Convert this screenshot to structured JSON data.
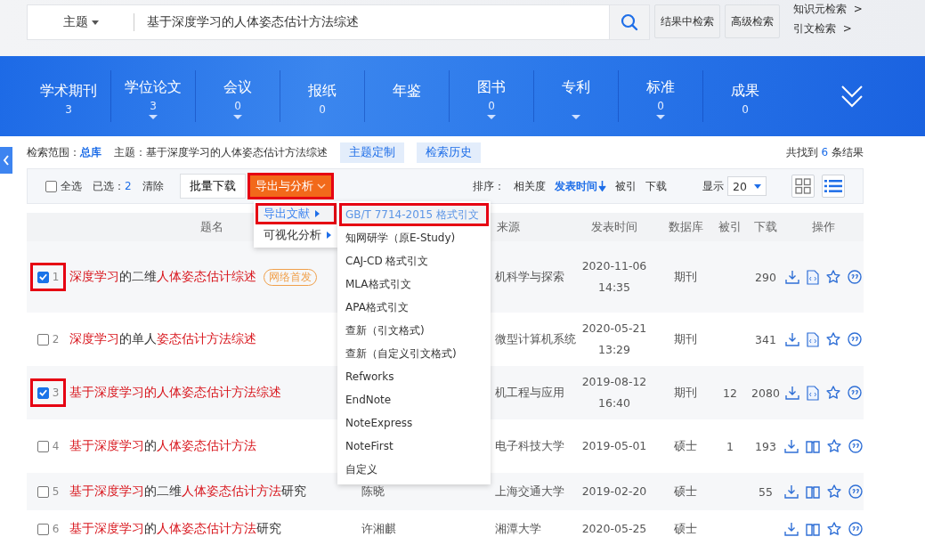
{
  "search": {
    "field": "主题",
    "query": "基于深度学习的人体姿态估计方法综述"
  },
  "search_buttons": [
    "结果中检索",
    "高级检索"
  ],
  "side_links": [
    {
      "label": "知识元检索",
      "arrow": ">"
    },
    {
      "label": "引文检索",
      "arrow": ">"
    }
  ],
  "categories": [
    {
      "label": "学术期刊",
      "count": "3",
      "caret": false
    },
    {
      "label": "学位论文",
      "count": "3",
      "caret": true
    },
    {
      "label": "会议",
      "count": "0",
      "caret": true
    },
    {
      "label": "报纸",
      "count": "0",
      "caret": false
    },
    {
      "label": "年鉴",
      "caret": false
    },
    {
      "label": "图书",
      "count": "0",
      "caret": true
    },
    {
      "label": "专利",
      "caret": true
    },
    {
      "label": "标准",
      "count": "0",
      "caret": true
    },
    {
      "label": "成果",
      "count": "0",
      "caret": false
    }
  ],
  "scope": {
    "label": "检索范围：",
    "value": "总库",
    "topic_label": "主题：",
    "topic": "基于深度学习的人体姿态估计方法综述",
    "tags": [
      "主题定制",
      "检索历史"
    ],
    "total_before": "共找到",
    "total": "6",
    "total_after": "条结果"
  },
  "toolbar": {
    "select_all": {
      "label": "全选",
      "checked": false
    },
    "selected_label": "已选：",
    "selected_count": "2",
    "clear": "清除",
    "batch_download": "批量下载",
    "export": {
      "label": "导出与分析",
      "highlighted": true
    },
    "sort_label": "排序：",
    "sort_options": [
      {
        "label": "相关度",
        "selected": false
      },
      {
        "label": "发表时间",
        "selected": true
      },
      {
        "label": "被引",
        "selected": false
      },
      {
        "label": "下载",
        "selected": false
      }
    ],
    "display_label": "显示",
    "display_value": "20",
    "views": [
      {
        "kind": "grid",
        "selected": false
      },
      {
        "kind": "list",
        "selected": true
      }
    ]
  },
  "columns": [
    "题名",
    "来源",
    "发表时间",
    "数据库",
    "被引",
    "下载",
    "操作"
  ],
  "rows": [
    {
      "index": "1",
      "checked": true,
      "highlighted": true,
      "title": [
        {
          "text": "深度学习",
          "hit": true
        },
        {
          "text": "的二维",
          "hit": false
        },
        {
          "text": "人体姿态估计综述",
          "hit": true
        }
      ],
      "badge": "网络首发",
      "source": "机科学与探索",
      "date": "2020-11-06",
      "time": "14:35",
      "database": "期刊",
      "downloads": "290",
      "kind": "html"
    },
    {
      "index": "2",
      "checked": false,
      "highlighted": false,
      "title": [
        {
          "text": "深度学习",
          "hit": true
        },
        {
          "text": "的单人",
          "hit": false
        },
        {
          "text": "姿态估计方法综述",
          "hit": true
        }
      ],
      "source": "微型计算机系统",
      "date": "2020-05-21",
      "time": "13:29",
      "database": "期刊",
      "downloads": "341",
      "kind": "html"
    },
    {
      "index": "3",
      "checked": true,
      "highlighted": true,
      "title": [
        {
          "text": "基于深度学习的人体姿态估计方法综述",
          "hit": true
        }
      ],
      "source": "机工程与应用",
      "date": "2019-08-12",
      "time": "16:40",
      "database": "期刊",
      "cited": "12",
      "downloads": "2080",
      "kind": "html"
    },
    {
      "index": "4",
      "checked": false,
      "highlighted": false,
      "title": [
        {
          "text": "基于深度学习",
          "hit": true
        },
        {
          "text": "的",
          "hit": false
        },
        {
          "text": "人体姿态估计方法",
          "hit": true
        }
      ],
      "source": "电子科技大学",
      "date": "2019-05-01",
      "database": "硕士",
      "cited": "1",
      "downloads": "193",
      "kind": "book"
    },
    {
      "index": "5",
      "checked": false,
      "highlighted": false,
      "title": [
        {
          "text": "基于深度学习",
          "hit": true
        },
        {
          "text": "的二维",
          "hit": false
        },
        {
          "text": "人体姿态估计方法",
          "hit": true
        },
        {
          "text": "研究",
          "hit": false
        }
      ],
      "author": "陈晓",
      "source": "上海交通大学",
      "date": "2019-02-20",
      "database": "硕士",
      "downloads": "55",
      "kind": "book"
    },
    {
      "index": "6",
      "checked": false,
      "highlighted": false,
      "title": [
        {
          "text": "基于深度学习",
          "hit": true
        },
        {
          "text": "的",
          "hit": false
        },
        {
          "text": "人体姿态估计方法",
          "hit": true
        },
        {
          "text": "研究",
          "hit": false
        }
      ],
      "author": "许湘麒",
      "source": "湘潭大学",
      "date": "2020-05-25",
      "database": "硕士",
      "kind": "book"
    }
  ],
  "menu": {
    "items": [
      {
        "label": "导出文献",
        "selected": true,
        "highlighted": true
      },
      {
        "label": "可视化分析",
        "selected": false,
        "highlighted": false
      }
    ],
    "submenu": [
      {
        "label": "GB/T 7714-2015 格式引文",
        "selected": true,
        "highlighted": true
      },
      {
        "label": "知网研学（原E-Study)",
        "selected": false,
        "highlighted": false
      },
      {
        "label": "CAJ-CD 格式引文",
        "selected": false,
        "highlighted": false
      },
      {
        "label": "MLA格式引文",
        "selected": false,
        "highlighted": false
      },
      {
        "label": "APA格式引文",
        "selected": false,
        "highlighted": false
      },
      {
        "label": "查新（引文格式)",
        "selected": false,
        "highlighted": false
      },
      {
        "label": "查新（自定义引文格式)",
        "selected": false,
        "highlighted": false
      },
      {
        "label": "Refworks",
        "selected": false,
        "highlighted": false
      },
      {
        "label": "EndNote",
        "selected": false,
        "highlighted": false
      },
      {
        "label": "NoteExpress",
        "selected": false,
        "highlighted": false
      },
      {
        "label": "NoteFirst",
        "selected": false,
        "highlighted": false
      },
      {
        "label": "自定义",
        "selected": false,
        "highlighted": false
      }
    ]
  }
}
